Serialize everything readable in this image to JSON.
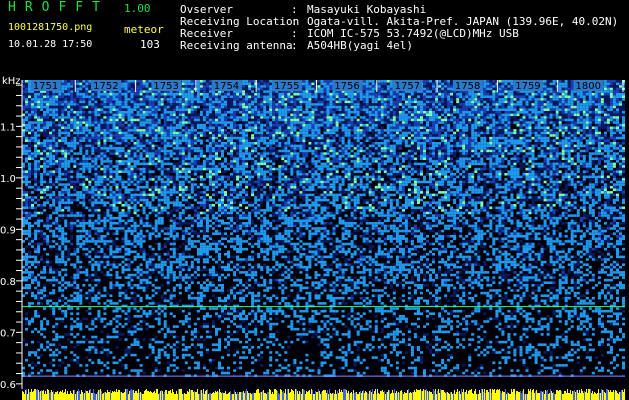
{
  "header": {
    "app_title": "HROFFT",
    "app_version": "1.00",
    "filename": "1001281750.png",
    "type_label": "meteor",
    "datetime": "10.01.28 17:50",
    "count": "103",
    "info": [
      {
        "label": "Ovserver",
        "value": "Masayuki Kobayashi"
      },
      {
        "label": "Receiving Location",
        "value": "Ogata-vill. Akita-Pref. JAPAN (139.96E, 40.02N)"
      },
      {
        "label": "Receiver",
        "value": "ICOM IC-575 53.7492(@LCD)MHz USB"
      },
      {
        "label": "Receiving antenna",
        "value": "A504HB(yagi 4el)"
      }
    ]
  },
  "chart_data": {
    "type": "heatmap",
    "ylabel": "kHz",
    "y_ticks": [
      "1.1",
      "1.0",
      "0.9",
      "0.8",
      "0.7",
      "0.6"
    ],
    "y_tick_values": [
      1.1,
      1.0,
      0.9,
      0.8,
      0.7,
      0.6
    ],
    "ylim": [
      0.59,
      1.19
    ],
    "x_ticks": [
      "1751",
      "1752",
      "1753",
      "1754",
      "1755",
      "1756",
      "1757",
      "1758",
      "1759",
      "1800"
    ],
    "x_tick_values": [
      1,
      2,
      3,
      4,
      5,
      6,
      7,
      8,
      9,
      10
    ],
    "xlim": [
      0,
      10
    ],
    "colors": {
      "noise_high": "#1f9bf0",
      "noise_mid": "#1a40b8",
      "noise_low": "#0a1a60",
      "peak": "#7fffb0",
      "carrier_line": "#33ff66",
      "lower_line": "#8a8aff",
      "bottom_strip": "#ffff00"
    },
    "carrier_khz": 0.75,
    "lower_line_khz": 0.615
  }
}
